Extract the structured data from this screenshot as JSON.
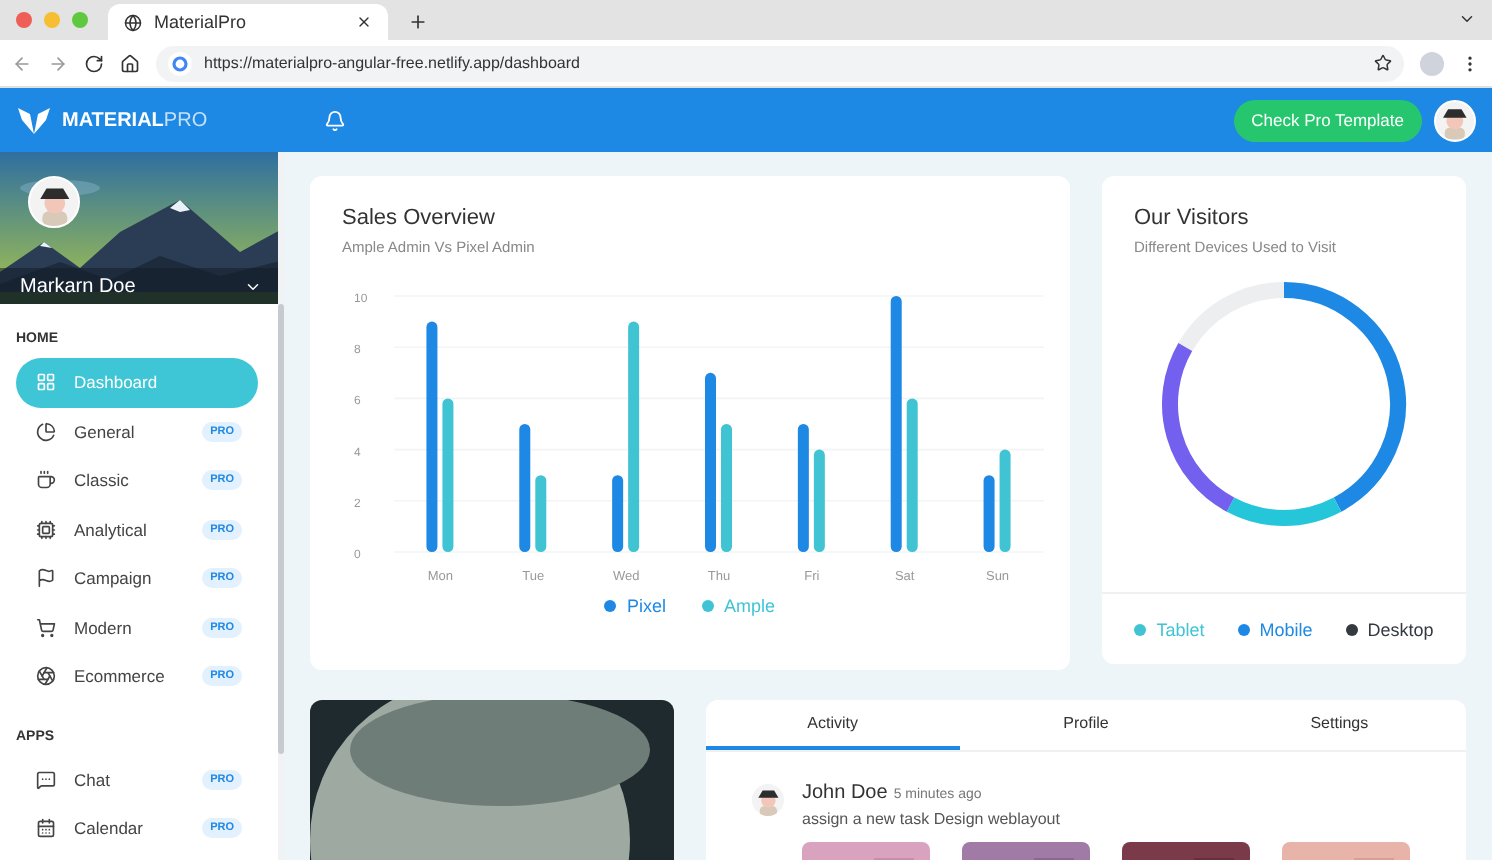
{
  "browser": {
    "tab_title": "MaterialPro",
    "url": "https://materialpro-angular-free.netlify.app/dashboard"
  },
  "header": {
    "logo_bold": "MATERIAL",
    "logo_light": "PRO",
    "button": "Check Pro Template"
  },
  "sidebar": {
    "user_name": "Markarn Doe",
    "sections": [
      {
        "title": "HOME",
        "items": [
          {
            "label": "Dashboard",
            "selected": true
          },
          {
            "label": "General",
            "badge": "PRO",
            "selected": false
          },
          {
            "label": "Classic",
            "badge": "PRO",
            "selected": false
          },
          {
            "label": "Analytical",
            "badge": "PRO",
            "selected": false
          },
          {
            "label": "Campaign",
            "badge": "PRO",
            "selected": false
          },
          {
            "label": "Modern",
            "badge": "PRO",
            "selected": false
          },
          {
            "label": "Ecommerce",
            "badge": "PRO",
            "selected": false
          }
        ]
      },
      {
        "title": "APPS",
        "items": [
          {
            "label": "Chat",
            "badge": "PRO",
            "selected": false
          },
          {
            "label": "Calendar",
            "badge": "PRO",
            "selected": false
          }
        ]
      }
    ]
  },
  "sales": {
    "title": "Sales Overview",
    "subtitle": "Ample Admin Vs Pixel Admin",
    "chart_data": {
      "type": "bar",
      "categories": [
        "Mon",
        "Tue",
        "Wed",
        "Thu",
        "Fri",
        "Sat",
        "Sun"
      ],
      "series": [
        {
          "name": "Pixel",
          "color": "#1e88e5",
          "values": [
            9,
            5,
            3,
            7,
            5,
            10,
            3
          ]
        },
        {
          "name": "Ample",
          "color": "#40c4d4",
          "values": [
            6,
            3,
            9,
            5,
            4,
            6,
            4
          ]
        }
      ],
      "ylim": [
        0,
        10
      ],
      "yticks": [
        0,
        2,
        4,
        6,
        8,
        10
      ],
      "grid": true
    }
  },
  "visitors": {
    "title": "Our Visitors",
    "subtitle": "Different Devices Used to Visit",
    "legend": [
      {
        "label": "Tablet",
        "color": "#40c4d4"
      },
      {
        "label": "Mobile",
        "color": "#1e88e5"
      },
      {
        "label": "Desktop",
        "color": "#343a40"
      }
    ]
  },
  "activity": {
    "tabs": [
      {
        "label": "Activity",
        "selected": true
      },
      {
        "label": "Profile",
        "selected": false
      },
      {
        "label": "Settings",
        "selected": false
      }
    ],
    "entries": [
      {
        "name": "John Doe",
        "time": "5 minutes ago",
        "text": "assign a new task Design weblayout"
      }
    ]
  }
}
